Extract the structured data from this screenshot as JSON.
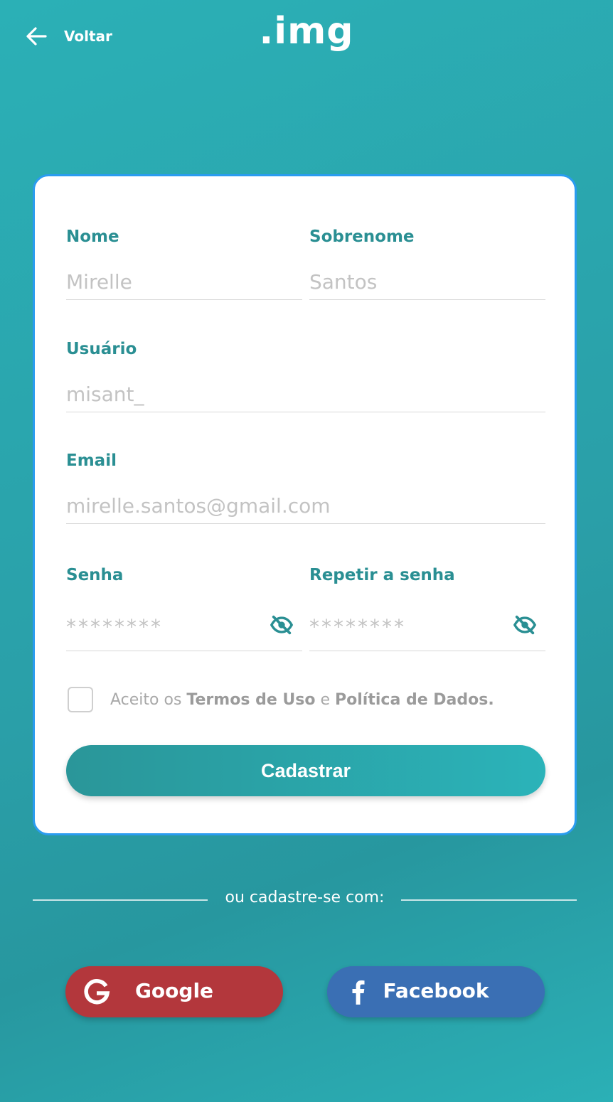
{
  "header": {
    "back_label": "Voltar",
    "logo": ".img"
  },
  "form": {
    "first_name": {
      "label": "Nome",
      "placeholder": "Mirelle"
    },
    "last_name": {
      "label": "Sobrenome",
      "placeholder": "Santos"
    },
    "username": {
      "label": "Usuário",
      "placeholder": "misant_"
    },
    "email": {
      "label": "Email",
      "placeholder": "mirelle.santos@gmail.com"
    },
    "password": {
      "label": "Senha",
      "placeholder": "********"
    },
    "password_repeat": {
      "label": "Repetir a senha",
      "placeholder": "********"
    },
    "terms": {
      "prefix": "Aceito os",
      "terms_link": "Termos de Uso",
      "connector": "e",
      "privacy_link": "Política de Dados."
    },
    "submit_label": "Cadastrar"
  },
  "social": {
    "divider_text": "ou cadastre-se com:",
    "google_label": "Google",
    "facebook_label": "Facebook"
  },
  "colors": {
    "accent": "#2a8f93",
    "card_border": "#2a9cf0",
    "google": "#b3373c",
    "facebook": "#3a6fb4"
  },
  "icons": [
    "arrow-left-icon",
    "eye-off-icon",
    "google-icon",
    "facebook-icon"
  ]
}
